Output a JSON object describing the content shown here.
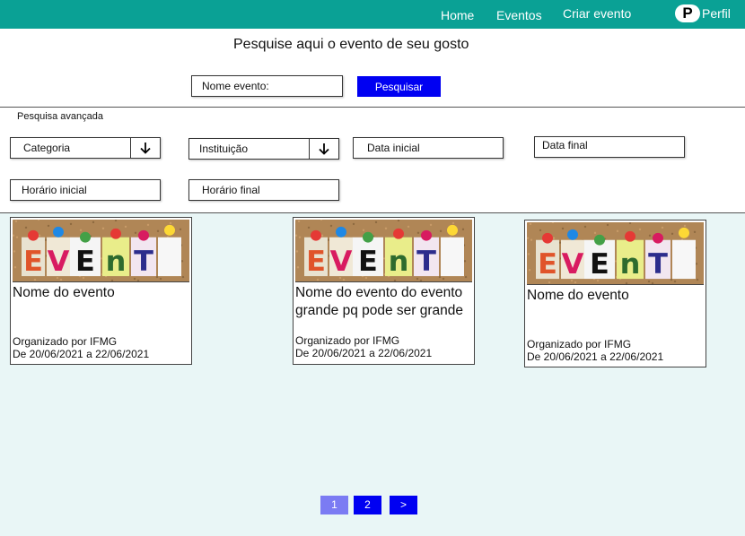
{
  "nav": {
    "home": "Home",
    "events": "Eventos",
    "create_event": "Criar evento",
    "profile_initial": "P",
    "profile": "Perfil"
  },
  "search": {
    "title": "Pesquise aqui o evento de seu gosto",
    "placeholder": "Nome evento:",
    "button": "Pesquisar"
  },
  "advanced": {
    "title": "Pesquisa avançada",
    "filters": {
      "categoria": "Categoria",
      "instituicao": "Instituição",
      "data_inicial": "Data inicial",
      "data_final": "Data final",
      "horario_inicial": "Horário inicial",
      "horario_final": "Horário final"
    }
  },
  "events": [
    {
      "image_word": "EVEnT",
      "name": "Nome do evento",
      "organizer": "Organizado por IFMG",
      "dates": "De 20/06/2021 a 22/06/2021"
    },
    {
      "image_word": "EVEnT",
      "name": "Nome do evento do evento grande pq pode ser grande",
      "organizer": "Organizado por IFMG",
      "dates": "De 20/06/2021 a 22/06/2021"
    },
    {
      "image_word": "EVEnT",
      "name": "Nome do evento",
      "organizer": "Organizado por IFMG",
      "dates": "De 20/06/2021 a 22/06/2021"
    }
  ],
  "pagination": {
    "pages": [
      "1",
      "2"
    ],
    "next": ">",
    "current": 1
  },
  "colors": {
    "navbar": "#0aa195",
    "primary_button": "#0000f2",
    "current_page": "#7b7bf3",
    "results_bg": "#e9f6f6"
  },
  "icons": {
    "filter_dropdown": "arrow-down-icon",
    "event_image": "event-corkboard-image"
  }
}
